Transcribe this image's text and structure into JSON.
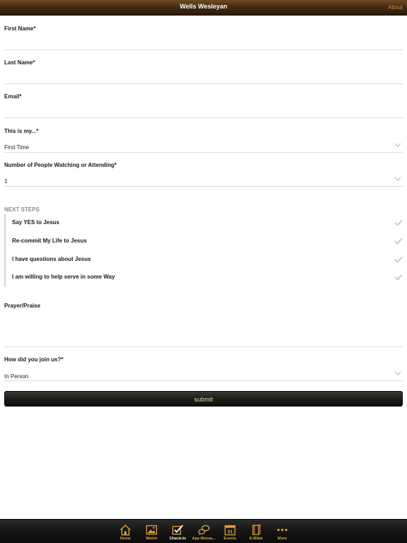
{
  "header": {
    "title": "Wells Wesleyan",
    "about": "About"
  },
  "form": {
    "first_name_label": "First Name*",
    "first_name_value": "",
    "last_name_label": "Last Name*",
    "last_name_value": "",
    "email_label": "Email*",
    "email_value": "",
    "this_is_my_label": "This is my...*",
    "this_is_my_value": "First Time",
    "people_label": "Number of People Watching or Attending*",
    "people_value": "1",
    "next_steps_heading": "NEXT STEPS",
    "next_steps": [
      {
        "label": "Say YES to Jesus"
      },
      {
        "label": "Re-commit My Life to Jesus"
      },
      {
        "label": "I have questions about Jesus"
      },
      {
        "label": "I am willing to help serve in some Way"
      }
    ],
    "prayer_label": "Prayer/Praise",
    "prayer_value": "",
    "join_label": "How did you join us?*",
    "join_value": "In Person",
    "submit_label": "submit"
  },
  "tabbar": {
    "items": [
      {
        "label": "Home",
        "icon": "home-icon"
      },
      {
        "label": "Watch",
        "icon": "image-icon"
      },
      {
        "label": "Check-In",
        "icon": "checkbox-icon"
      },
      {
        "label": "App Messa...",
        "icon": "chat-icon"
      },
      {
        "label": "Events",
        "icon": "calendar-icon",
        "day": "31"
      },
      {
        "label": "E-Bible",
        "icon": "book-icon"
      },
      {
        "label": "More",
        "icon": "more-icon"
      }
    ]
  },
  "colors": {
    "accent": "#e0a040",
    "header": "#3e2710",
    "about": "#c98a2e"
  }
}
